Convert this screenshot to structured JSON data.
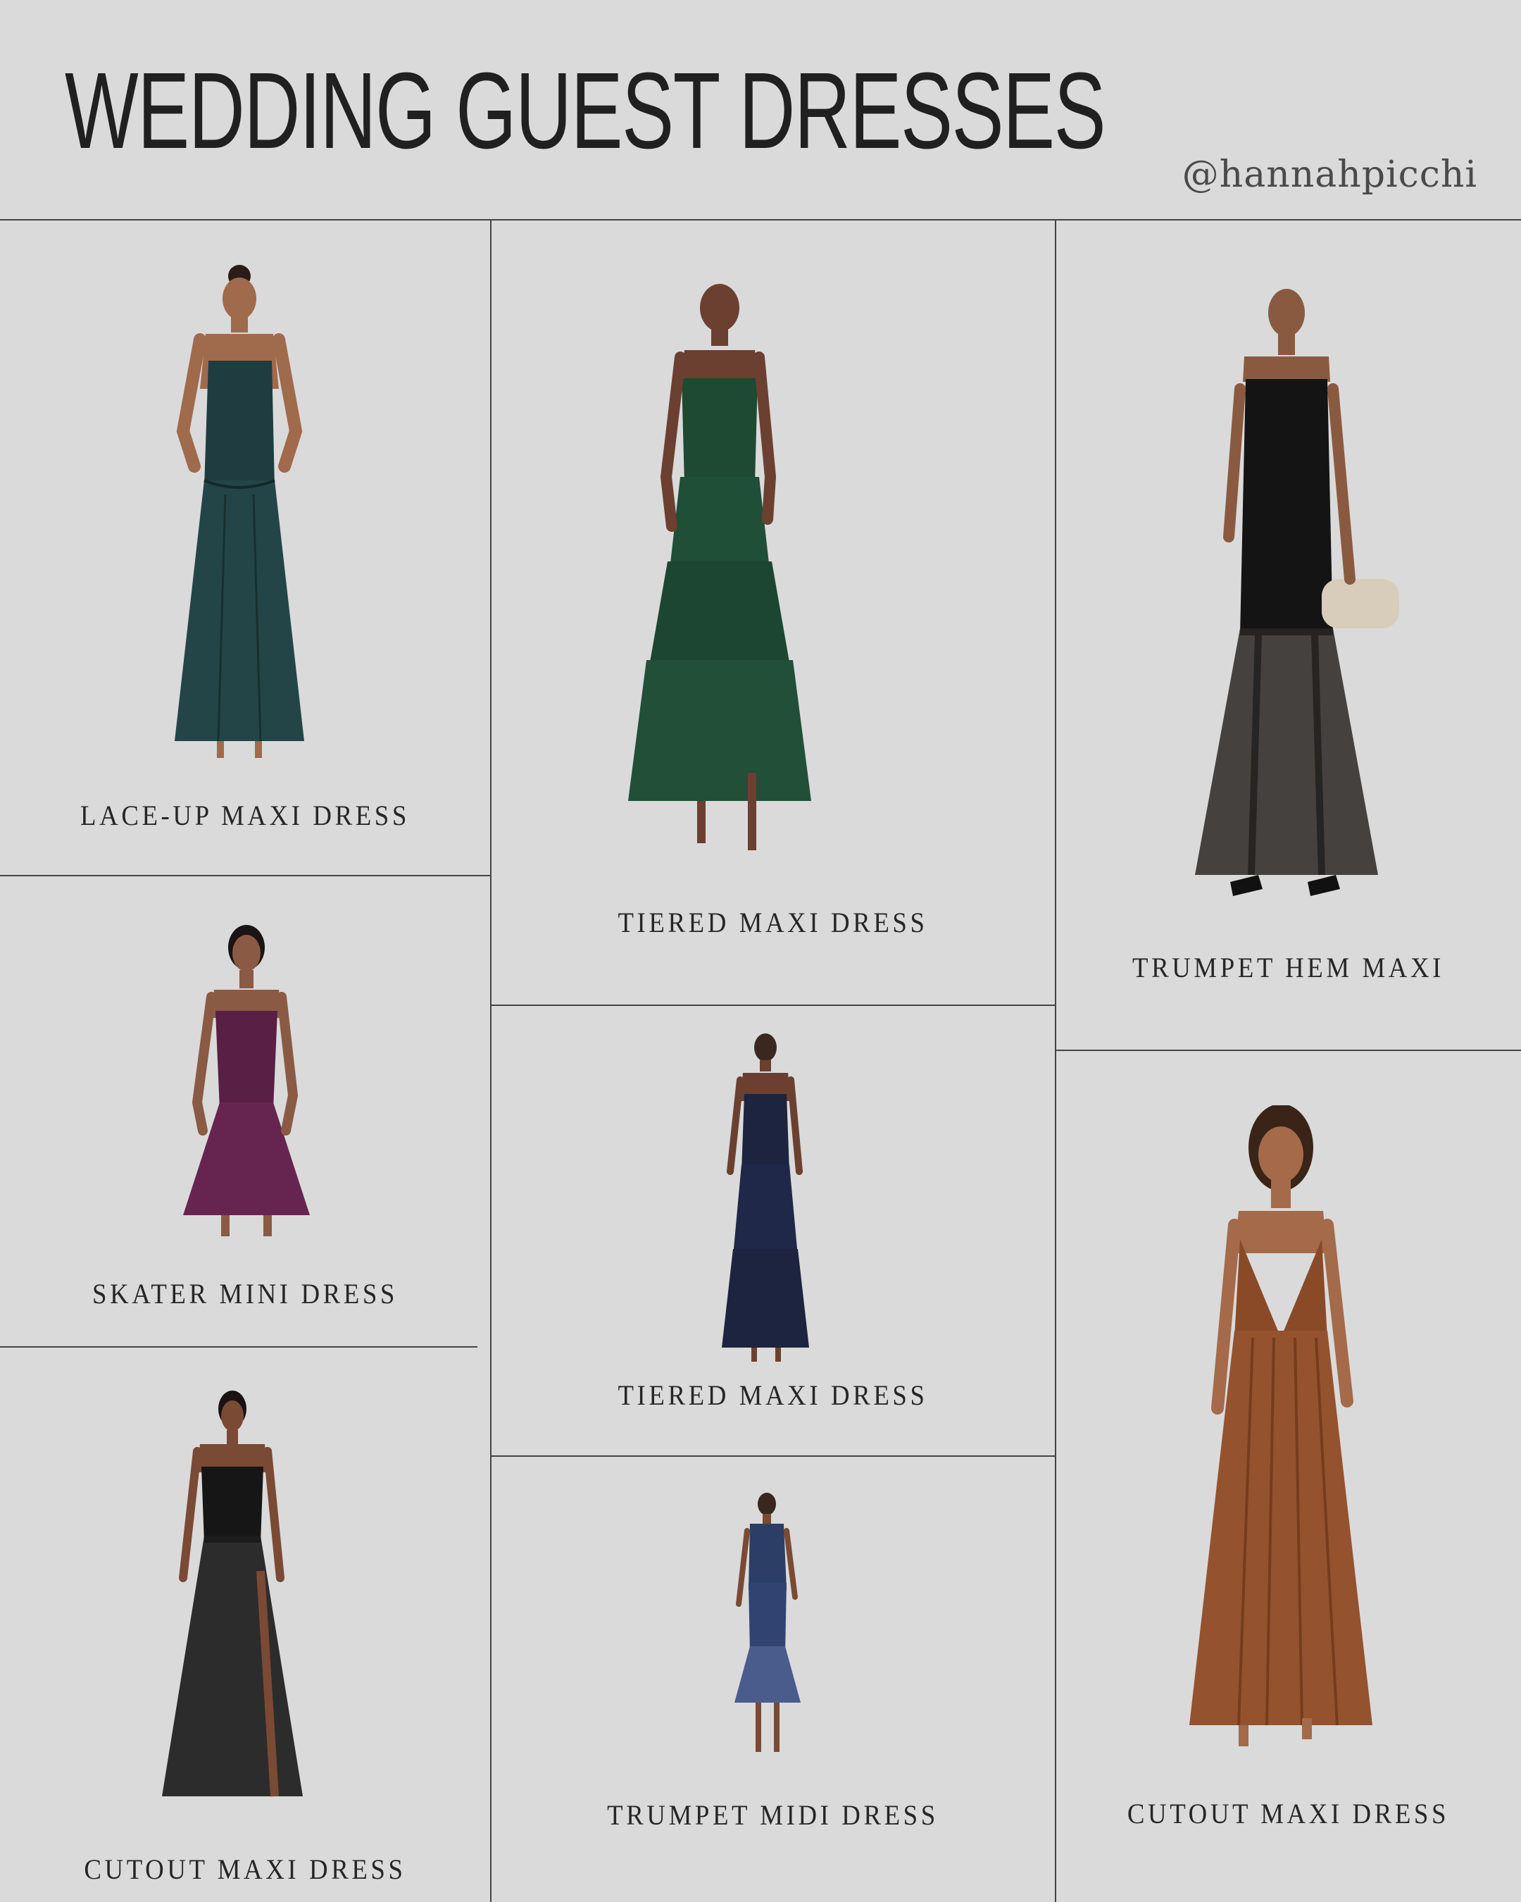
{
  "header": {
    "title": "WEDDING GUEST DRESSES",
    "handle": "@hannahpicchi"
  },
  "products": [
    {
      "label": "LACE-UP MAXI DRESS",
      "image": "dress-teal-satin",
      "color": "#1f3d40"
    },
    {
      "label": "TIERED MAXI DRESS",
      "image": "dress-green-tiered",
      "color": "#1e4a33"
    },
    {
      "label": "TRUMPET HEM MAXI",
      "image": "dress-black-velvet-sheer",
      "color": "#151515"
    },
    {
      "label": "SKATER MINI DRESS",
      "image": "dress-plum-satin-mini",
      "color": "#5a1f44"
    },
    {
      "label": "TIERED MAXI DRESS",
      "image": "dress-navy-tiered",
      "color": "#1c2440"
    },
    {
      "label": "CUTOUT MAXI DRESS",
      "image": "dress-black-organza",
      "color": "#141414"
    },
    {
      "label": "TRUMPET MIDI DRESS",
      "image": "dress-blue-floral-midi",
      "color": "#2c3e66"
    },
    {
      "label": "CUTOUT MAXI DRESS",
      "image": "dress-copper-pleated",
      "color": "#8a4a28"
    }
  ]
}
